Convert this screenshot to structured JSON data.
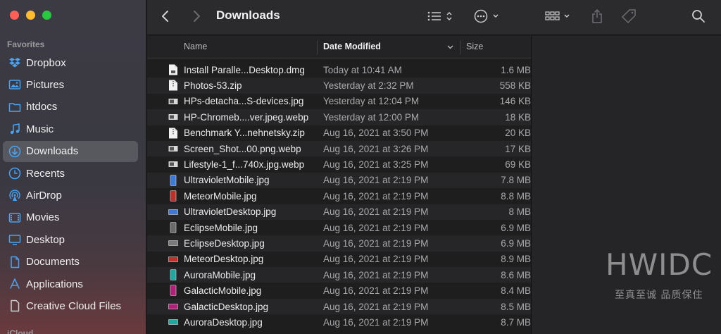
{
  "window": {
    "title": "Downloads"
  },
  "sidebar": {
    "favorites_header": "Favorites",
    "icloud_header": "iCloud",
    "accent_color": "#4aa3f0",
    "items": [
      {
        "label": "Dropbox",
        "icon": "dropbox-icon"
      },
      {
        "label": "Pictures",
        "icon": "pictures-icon"
      },
      {
        "label": "htdocs",
        "icon": "folder-icon"
      },
      {
        "label": "Music",
        "icon": "music-icon"
      },
      {
        "label": "Downloads",
        "icon": "downloads-icon",
        "active": true
      },
      {
        "label": "Recents",
        "icon": "clock-icon"
      },
      {
        "label": "AirDrop",
        "icon": "airdrop-icon"
      },
      {
        "label": "Movies",
        "icon": "movies-icon"
      },
      {
        "label": "Desktop",
        "icon": "desktop-icon"
      },
      {
        "label": "Documents",
        "icon": "document-icon"
      },
      {
        "label": "Applications",
        "icon": "applications-icon"
      },
      {
        "label": "Creative Cloud Files",
        "icon": "file-icon"
      }
    ]
  },
  "columns": {
    "name": "Name",
    "date": "Date Modified",
    "size": "Size",
    "sorted_by": "Date Modified"
  },
  "files": [
    {
      "name": "Install Paralle...Desktop.dmg",
      "date": "Today at 10:41 AM",
      "size": "1.6 MB",
      "icon": "dmg-file-icon"
    },
    {
      "name": "Photos-53.zip",
      "date": "Yesterday at 2:32 PM",
      "size": "558 KB",
      "icon": "zip-file-icon"
    },
    {
      "name": "HPs-detacha...S-devices.jpg",
      "date": "Yesterday at 12:04 PM",
      "size": "146 KB",
      "icon": "image-thumbnail-icon"
    },
    {
      "name": "HP-Chromeb....ver.jpeg.webp",
      "date": "Yesterday at 12:00 PM",
      "size": "18 KB",
      "icon": "image-thumbnail-icon"
    },
    {
      "name": "Benchmark Y...nehnetsky.zip",
      "date": "Aug 16, 2021 at 3:50 PM",
      "size": "20 KB",
      "icon": "zip-file-icon"
    },
    {
      "name": "Screen_Shot...00.png.webp",
      "date": "Aug 16, 2021 at 3:26 PM",
      "size": "17 KB",
      "icon": "image-thumbnail-icon"
    },
    {
      "name": "Lifestyle-1_f...740x.jpg.webp",
      "date": "Aug 16, 2021 at 3:25 PM",
      "size": "69 KB",
      "icon": "image-thumbnail-icon"
    },
    {
      "name": "UltravioletMobile.jpg",
      "date": "Aug 16, 2021 at 2:19 PM",
      "size": "7.8 MB",
      "icon": "phone-thumbnail-icon",
      "color": "#3a7bd5"
    },
    {
      "name": "MeteorMobile.jpg",
      "date": "Aug 16, 2021 at 2:19 PM",
      "size": "8.8 MB",
      "icon": "phone-thumbnail-icon",
      "color": "#c0302b"
    },
    {
      "name": "UltravioletDesktop.jpg",
      "date": "Aug 16, 2021 at 2:19 PM",
      "size": "8 MB",
      "icon": "desktop-thumbnail-icon",
      "color": "#3a7bd5"
    },
    {
      "name": "EclipseMobile.jpg",
      "date": "Aug 16, 2021 at 2:19 PM",
      "size": "6.9 MB",
      "icon": "phone-thumbnail-icon",
      "color": "#6a6a6a"
    },
    {
      "name": "EclipseDesktop.jpg",
      "date": "Aug 16, 2021 at 2:19 PM",
      "size": "6.9 MB",
      "icon": "desktop-thumbnail-icon",
      "color": "#7a7a7a"
    },
    {
      "name": "MeteorDesktop.jpg",
      "date": "Aug 16, 2021 at 2:19 PM",
      "size": "8.9 MB",
      "icon": "desktop-thumbnail-icon",
      "color": "#c0302b"
    },
    {
      "name": "AuroraMobile.jpg",
      "date": "Aug 16, 2021 at 2:19 PM",
      "size": "8.6 MB",
      "icon": "phone-thumbnail-icon",
      "color": "#1fa7a0"
    },
    {
      "name": "GalacticMobile.jpg",
      "date": "Aug 16, 2021 at 2:19 PM",
      "size": "8.4 MB",
      "icon": "phone-thumbnail-icon",
      "color": "#b0207a"
    },
    {
      "name": "GalacticDesktop.jpg",
      "date": "Aug 16, 2021 at 2:19 PM",
      "size": "8.5 MB",
      "icon": "desktop-thumbnail-icon",
      "color": "#b0207a"
    },
    {
      "name": "AuroraDesktop.jpg",
      "date": "Aug 16, 2021 at 2:19 PM",
      "size": "8.7 MB",
      "icon": "desktop-thumbnail-icon",
      "color": "#1fa7a0"
    }
  ],
  "watermark": {
    "brand": "HWIDC",
    "tagline": "至真至诚 品质保住"
  }
}
